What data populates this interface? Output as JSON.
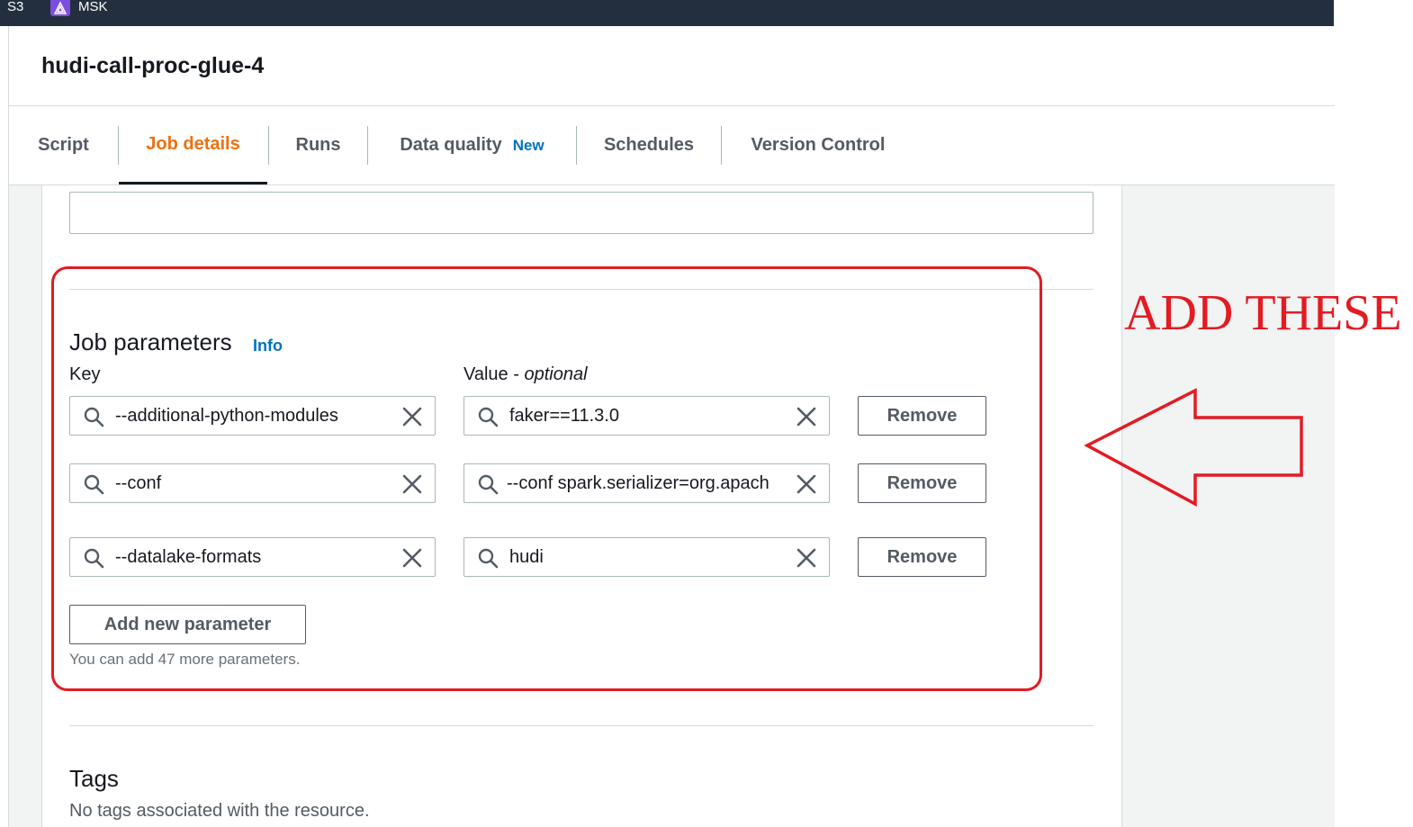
{
  "topbar": {
    "s3_label": "S3",
    "msk_label": "MSK"
  },
  "job": {
    "title": "hudi-call-proc-glue-4"
  },
  "tabs": [
    {
      "label": "Script"
    },
    {
      "label": "Job details"
    },
    {
      "label": "Runs"
    },
    {
      "label": "Data quality",
      "badge": "New"
    },
    {
      "label": "Schedules"
    },
    {
      "label": "Version Control"
    }
  ],
  "job_parameters": {
    "title": "Job parameters",
    "info_label": "Info",
    "key_label": "Key",
    "value_label": "Value - ",
    "value_optional": "optional",
    "rows": [
      {
        "key": "--additional-python-modules",
        "value": "faker==11.3.0",
        "remove_label": "Remove"
      },
      {
        "key": "--conf",
        "value": "--conf spark.serializer=org.apach",
        "remove_label": "Remove"
      },
      {
        "key": "--datalake-formats",
        "value": "hudi",
        "remove_label": "Remove"
      }
    ],
    "add_button_label": "Add new parameter",
    "hint": "You can add 47 more parameters."
  },
  "tags": {
    "title": "Tags",
    "empty_text": "No tags associated with the resource."
  },
  "annotation": {
    "text": "ADD THESE",
    "color": "#e31b23"
  },
  "colors": {
    "accent": "#ec7211",
    "link": "#0073bb",
    "topbar": "#232f3e"
  }
}
